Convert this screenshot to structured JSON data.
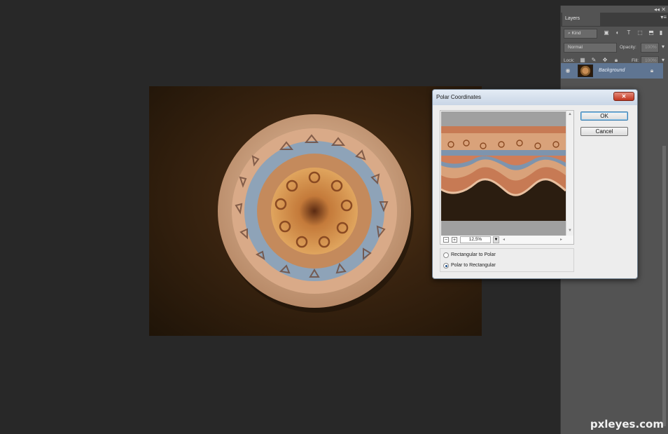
{
  "layers_panel": {
    "tab_label": "Layers",
    "filter_kind": "Kind",
    "blend_mode": "Normal",
    "opacity_label": "Opacity:",
    "opacity_value": "100%",
    "lock_label": "Lock:",
    "fill_label": "Fill:",
    "fill_value": "100%",
    "layer_name": "Background"
  },
  "dialog": {
    "title": "Polar Coordinates",
    "ok_label": "OK",
    "cancel_label": "Cancel",
    "zoom_value": "12,5%",
    "option_rect_to_polar": "Rectangular to Polar",
    "option_polar_to_rect": "Polar to Rectangular",
    "selected_option": "Polar to Rectangular"
  },
  "watermark": "pxleyes.com"
}
